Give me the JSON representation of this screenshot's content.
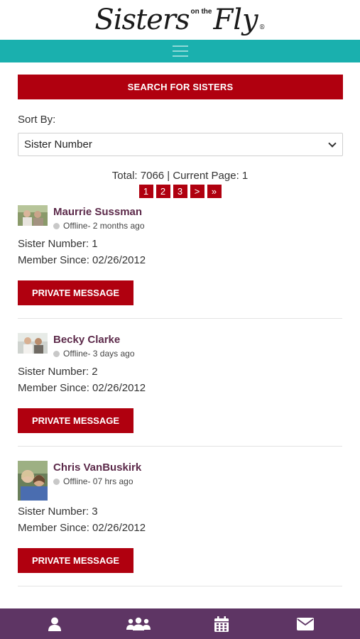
{
  "header": {
    "logo_word1": "Sisters",
    "logo_middle": "on the",
    "logo_word2": "Fly",
    "logo_reg": "®"
  },
  "nav": {
    "menu_icon": "hamburger-icon"
  },
  "search": {
    "button_label": "SEARCH FOR SISTERS"
  },
  "sort": {
    "label": "Sort By:",
    "selected": "Sister Number"
  },
  "summary": {
    "text": "Total: 7066 | Current Page: 1"
  },
  "pagination": [
    "1",
    "2",
    "3",
    ">",
    "»"
  ],
  "members": [
    {
      "name": "Maurrie Sussman",
      "status": "Offline- 2 months ago",
      "sister_number": "Sister Number: 1",
      "member_since": "Member Since: 02/26/2012",
      "button": "PRIVATE MESSAGE"
    },
    {
      "name": "Becky Clarke",
      "status": "Offline- 3 days ago",
      "sister_number": "Sister Number: 2",
      "member_since": "Member Since: 02/26/2012",
      "button": "PRIVATE MESSAGE"
    },
    {
      "name": "Chris VanBuskirk",
      "status": "Offline- 07 hrs ago",
      "sister_number": "Sister Number: 3",
      "member_since": "Member Since: 02/26/2012",
      "button": "PRIVATE MESSAGE"
    }
  ],
  "bottom_nav": {
    "icons": [
      "user-icon",
      "group-icon",
      "calendar-icon",
      "envelope-icon"
    ]
  },
  "colors": {
    "accent_red": "#b0000f",
    "teal": "#1ab0ae",
    "purple": "#5e3564",
    "name_color": "#5c2a4a"
  }
}
